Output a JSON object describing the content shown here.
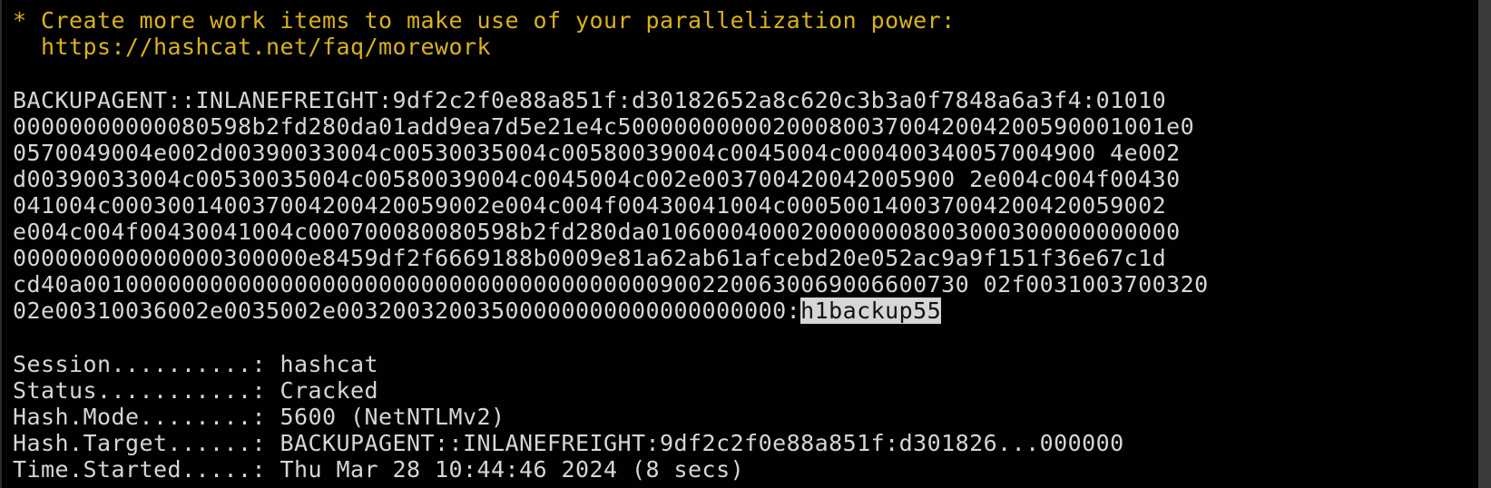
{
  "tip": {
    "line1": "* Create more work items to make use of your parallelization power:",
    "line2": "  https://hashcat.net/faq/morework"
  },
  "hash_lines": [
    "BACKUPAGENT::INLANEFREIGHT:9df2c2f0e88a851f:d30182652a8c620c3b3a0f7848a6a3f4:01010",
    "00000000000080598b2fd280da01add9ea7d5e21e4c500000000002000800370042004200590001001e0",
    "0570049004e002d00390033004c00530035004c00580039004c0045004c000400340057004900 4e002",
    "d00390033004c00530035004c00580039004c0045004c002e003700420042005900 2e004c004f00430",
    "041004c000300140037004200420059002e004c004f00430041004c000500140037004200420059002",
    "e004c004f00430041004c000700080080598b2fd280da01060004000200000008003000300000000000",
    "000000000000000300000e8459df2f6669188b0009e81a62ab61afcebd20e052ac9a9f151f36e67c1d",
    "cd40a001000000000000000000000000000000000000009002200630069006600730 02f0031003700320",
    "02e00310036002e0035002e00320032003500000000000000000000:"
  ],
  "cracked_password": "h1backup55",
  "status": {
    "session": "Session..........: hashcat",
    "status": "Status...........: Cracked",
    "hash_mode": "Hash.Mode........: 5600 (NetNTLMv2)",
    "hash_target": "Hash.Target......: BACKUPAGENT::INLANEFREIGHT:9df2c2f0e88a851f:d301826...000000",
    "time_started": "Time.Started.....: Thu Mar 28 10:44:46 2024 (8 secs)"
  }
}
